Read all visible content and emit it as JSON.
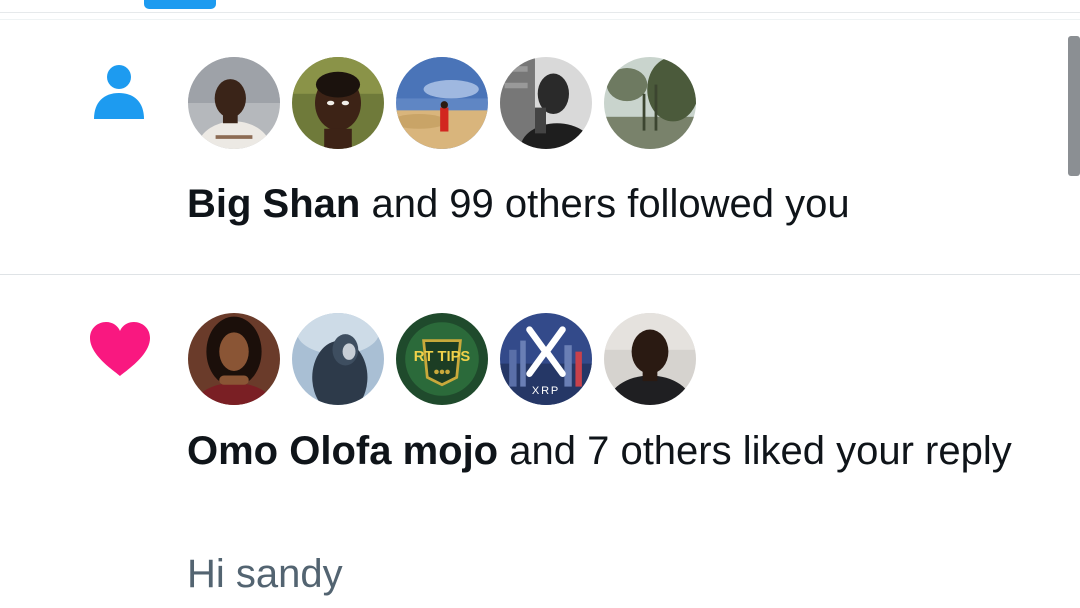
{
  "colors": {
    "accent": "#1d9bf0",
    "like": "#f91880",
    "text_primary": "#0f1419",
    "text_secondary": "#536471"
  },
  "notifications": [
    {
      "type": "follow",
      "icon": "person-icon",
      "actor": "Big Shan",
      "message": " and 99 others followed you",
      "avatars": [
        "avatar-user-1",
        "avatar-user-2",
        "avatar-user-3",
        "avatar-user-4",
        "avatar-user-5"
      ]
    },
    {
      "type": "like",
      "icon": "heart-icon",
      "actor": "Omo Olofa mojo",
      "message": " and 7 others liked your reply",
      "snippet": "Hi sandy",
      "avatars": [
        "avatar-user-1",
        "avatar-user-2",
        "avatar-rt-tips",
        "avatar-xrp",
        "avatar-user-5"
      ],
      "avatar_texts": {
        "rt_tips": "RT TIPS",
        "xrp": "XRP"
      }
    }
  ]
}
